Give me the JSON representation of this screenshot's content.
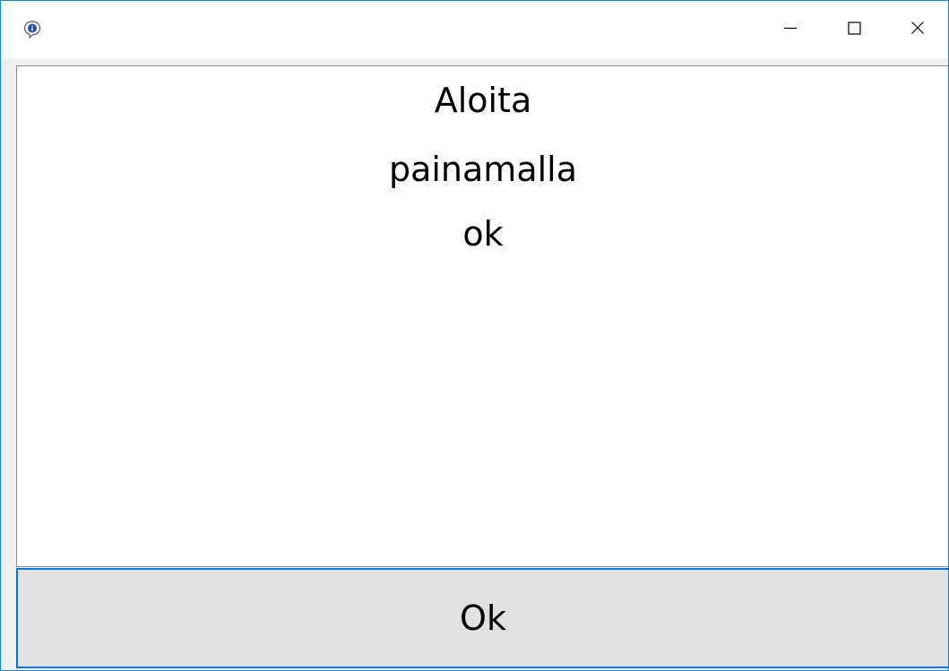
{
  "window": {
    "title": "",
    "icon": "info-icon"
  },
  "titlebar": {
    "minimize_icon": "minimize-icon",
    "maximize_icon": "maximize-icon",
    "close_icon": "close-icon"
  },
  "message": {
    "lines": [
      "Aloita",
      "painamalla",
      "ok"
    ]
  },
  "ok_button": {
    "label": "Ok"
  },
  "colors": {
    "focus_border": "#0078d7",
    "button_face": "#e1e1e1",
    "window_border": "#1883d7"
  }
}
